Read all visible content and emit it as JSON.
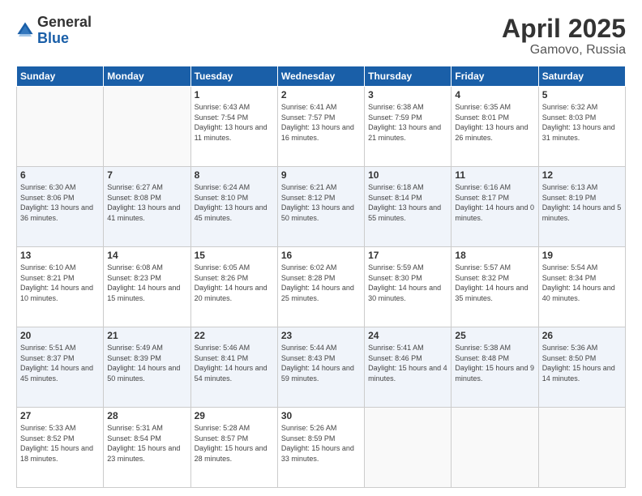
{
  "logo": {
    "general": "General",
    "blue": "Blue"
  },
  "title": "April 2025",
  "location": "Gamovo, Russia",
  "days_header": [
    "Sunday",
    "Monday",
    "Tuesday",
    "Wednesday",
    "Thursday",
    "Friday",
    "Saturday"
  ],
  "weeks": [
    [
      {
        "day": "",
        "info": ""
      },
      {
        "day": "",
        "info": ""
      },
      {
        "day": "1",
        "info": "Sunrise: 6:43 AM\nSunset: 7:54 PM\nDaylight: 13 hours and 11 minutes."
      },
      {
        "day": "2",
        "info": "Sunrise: 6:41 AM\nSunset: 7:57 PM\nDaylight: 13 hours and 16 minutes."
      },
      {
        "day": "3",
        "info": "Sunrise: 6:38 AM\nSunset: 7:59 PM\nDaylight: 13 hours and 21 minutes."
      },
      {
        "day": "4",
        "info": "Sunrise: 6:35 AM\nSunset: 8:01 PM\nDaylight: 13 hours and 26 minutes."
      },
      {
        "day": "5",
        "info": "Sunrise: 6:32 AM\nSunset: 8:03 PM\nDaylight: 13 hours and 31 minutes."
      }
    ],
    [
      {
        "day": "6",
        "info": "Sunrise: 6:30 AM\nSunset: 8:06 PM\nDaylight: 13 hours and 36 minutes."
      },
      {
        "day": "7",
        "info": "Sunrise: 6:27 AM\nSunset: 8:08 PM\nDaylight: 13 hours and 41 minutes."
      },
      {
        "day": "8",
        "info": "Sunrise: 6:24 AM\nSunset: 8:10 PM\nDaylight: 13 hours and 45 minutes."
      },
      {
        "day": "9",
        "info": "Sunrise: 6:21 AM\nSunset: 8:12 PM\nDaylight: 13 hours and 50 minutes."
      },
      {
        "day": "10",
        "info": "Sunrise: 6:18 AM\nSunset: 8:14 PM\nDaylight: 13 hours and 55 minutes."
      },
      {
        "day": "11",
        "info": "Sunrise: 6:16 AM\nSunset: 8:17 PM\nDaylight: 14 hours and 0 minutes."
      },
      {
        "day": "12",
        "info": "Sunrise: 6:13 AM\nSunset: 8:19 PM\nDaylight: 14 hours and 5 minutes."
      }
    ],
    [
      {
        "day": "13",
        "info": "Sunrise: 6:10 AM\nSunset: 8:21 PM\nDaylight: 14 hours and 10 minutes."
      },
      {
        "day": "14",
        "info": "Sunrise: 6:08 AM\nSunset: 8:23 PM\nDaylight: 14 hours and 15 minutes."
      },
      {
        "day": "15",
        "info": "Sunrise: 6:05 AM\nSunset: 8:26 PM\nDaylight: 14 hours and 20 minutes."
      },
      {
        "day": "16",
        "info": "Sunrise: 6:02 AM\nSunset: 8:28 PM\nDaylight: 14 hours and 25 minutes."
      },
      {
        "day": "17",
        "info": "Sunrise: 5:59 AM\nSunset: 8:30 PM\nDaylight: 14 hours and 30 minutes."
      },
      {
        "day": "18",
        "info": "Sunrise: 5:57 AM\nSunset: 8:32 PM\nDaylight: 14 hours and 35 minutes."
      },
      {
        "day": "19",
        "info": "Sunrise: 5:54 AM\nSunset: 8:34 PM\nDaylight: 14 hours and 40 minutes."
      }
    ],
    [
      {
        "day": "20",
        "info": "Sunrise: 5:51 AM\nSunset: 8:37 PM\nDaylight: 14 hours and 45 minutes."
      },
      {
        "day": "21",
        "info": "Sunrise: 5:49 AM\nSunset: 8:39 PM\nDaylight: 14 hours and 50 minutes."
      },
      {
        "day": "22",
        "info": "Sunrise: 5:46 AM\nSunset: 8:41 PM\nDaylight: 14 hours and 54 minutes."
      },
      {
        "day": "23",
        "info": "Sunrise: 5:44 AM\nSunset: 8:43 PM\nDaylight: 14 hours and 59 minutes."
      },
      {
        "day": "24",
        "info": "Sunrise: 5:41 AM\nSunset: 8:46 PM\nDaylight: 15 hours and 4 minutes."
      },
      {
        "day": "25",
        "info": "Sunrise: 5:38 AM\nSunset: 8:48 PM\nDaylight: 15 hours and 9 minutes."
      },
      {
        "day": "26",
        "info": "Sunrise: 5:36 AM\nSunset: 8:50 PM\nDaylight: 15 hours and 14 minutes."
      }
    ],
    [
      {
        "day": "27",
        "info": "Sunrise: 5:33 AM\nSunset: 8:52 PM\nDaylight: 15 hours and 18 minutes."
      },
      {
        "day": "28",
        "info": "Sunrise: 5:31 AM\nSunset: 8:54 PM\nDaylight: 15 hours and 23 minutes."
      },
      {
        "day": "29",
        "info": "Sunrise: 5:28 AM\nSunset: 8:57 PM\nDaylight: 15 hours and 28 minutes."
      },
      {
        "day": "30",
        "info": "Sunrise: 5:26 AM\nSunset: 8:59 PM\nDaylight: 15 hours and 33 minutes."
      },
      {
        "day": "",
        "info": ""
      },
      {
        "day": "",
        "info": ""
      },
      {
        "day": "",
        "info": ""
      }
    ]
  ]
}
